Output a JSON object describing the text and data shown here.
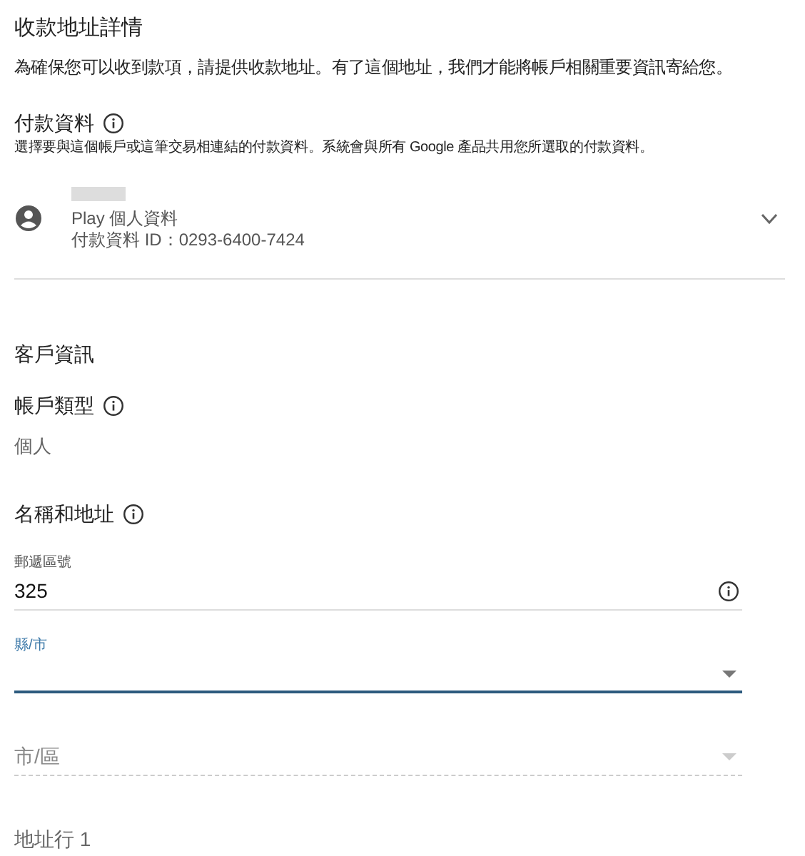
{
  "page": {
    "title": "收款地址詳情",
    "description": "為確保您可以收到款項，請提供收款地址。有了這個地址，我們才能將帳戶相關重要資訊寄給您。"
  },
  "payment_profile": {
    "heading": "付款資料",
    "note": "選擇要與這個帳戶或這筆交易相連結的付款資料。系統會與所有 Google 產品共用您所選取的付款資料。",
    "name_redacted": true,
    "profile_type": "Play 個人資料",
    "profile_id": "付款資料 ID：0293-6400-7424",
    "expanded": false
  },
  "customer": {
    "heading": "客戶資訊",
    "account_type_label": "帳戶類型",
    "account_type_value": "個人",
    "address_heading": "名稱和地址"
  },
  "fields": [
    {
      "kind": "text",
      "label": "郵遞區號",
      "value": "325",
      "info": true,
      "focused": false,
      "disabled": false
    },
    {
      "kind": "select",
      "label": "縣/市",
      "info": false,
      "focused": true,
      "disabled": false
    },
    {
      "kind": "select",
      "label": "市/區",
      "info": false,
      "focused": false,
      "disabled": true
    },
    {
      "kind": "text",
      "label": "地址行 1",
      "info": false,
      "focused": false,
      "disabled": false
    }
  ]
}
